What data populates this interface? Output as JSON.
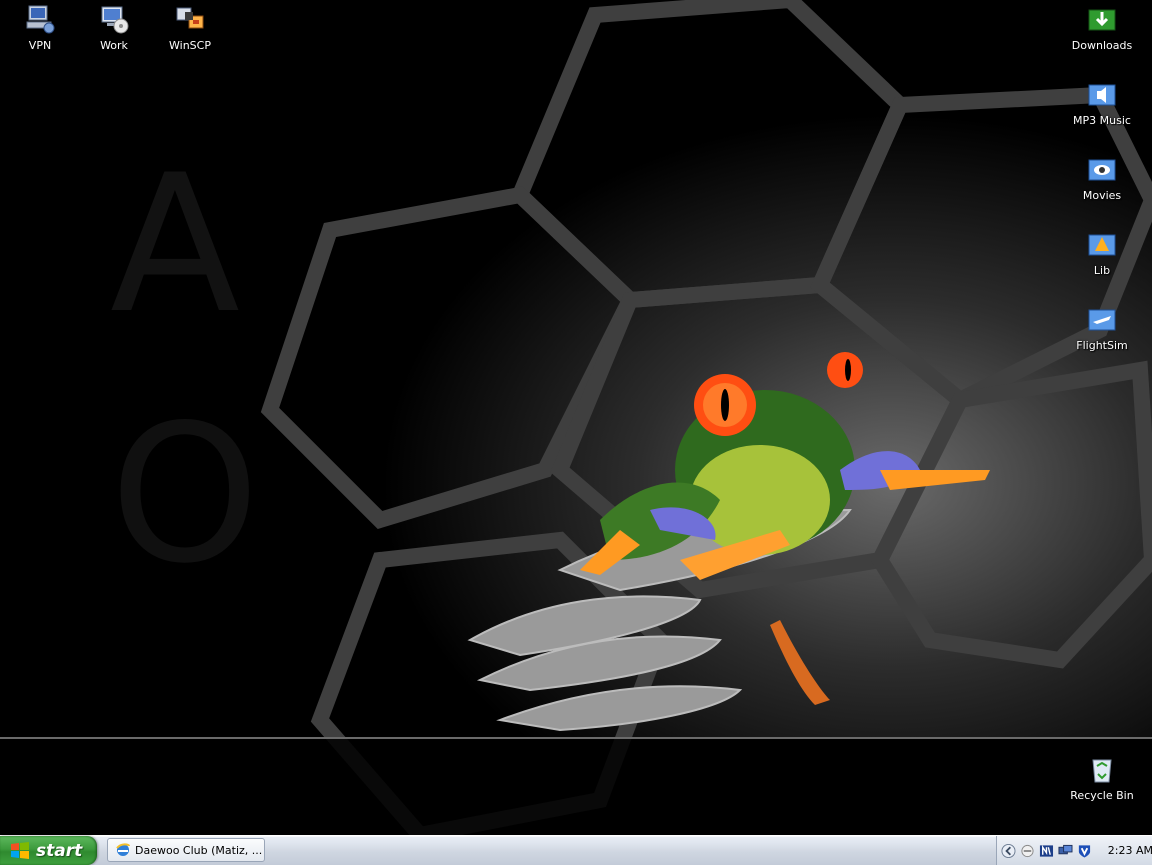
{
  "desktop": {
    "icons_left": [
      {
        "label": "VPN",
        "icon": "network-computer-icon"
      },
      {
        "label": "Work",
        "icon": "monitor-disc-icon"
      },
      {
        "label": "WinSCP",
        "icon": "winscp-icon"
      }
    ],
    "icons_right": [
      {
        "label": "Downloads",
        "icon": "download-folder-icon"
      },
      {
        "label": "MP3 Music",
        "icon": "music-folder-icon"
      },
      {
        "label": "Movies",
        "icon": "movies-folder-icon"
      },
      {
        "label": "Lib",
        "icon": "lib-folder-icon"
      },
      {
        "label": "FlightSim",
        "icon": "flightsim-folder-icon"
      }
    ],
    "recycle_bin": {
      "label": "Recycle Bin",
      "icon": "recycle-bin-icon"
    }
  },
  "taskbar": {
    "start_label": "start",
    "tasks": [
      {
        "label": "Daewoo Club (Matiz, ...",
        "icon": "internet-explorer-icon"
      }
    ],
    "tray": {
      "icons": [
        "show-hidden-icons-chevron",
        "volume-icon",
        "network-icon",
        "display-icon",
        "antivirus-v-icon"
      ],
      "clock": "2:23 AM"
    }
  },
  "colors": {
    "taskbar_bg": "#d3dae5",
    "start_green": "#3c9a3c",
    "frog_orange": "#ff5a1a"
  }
}
